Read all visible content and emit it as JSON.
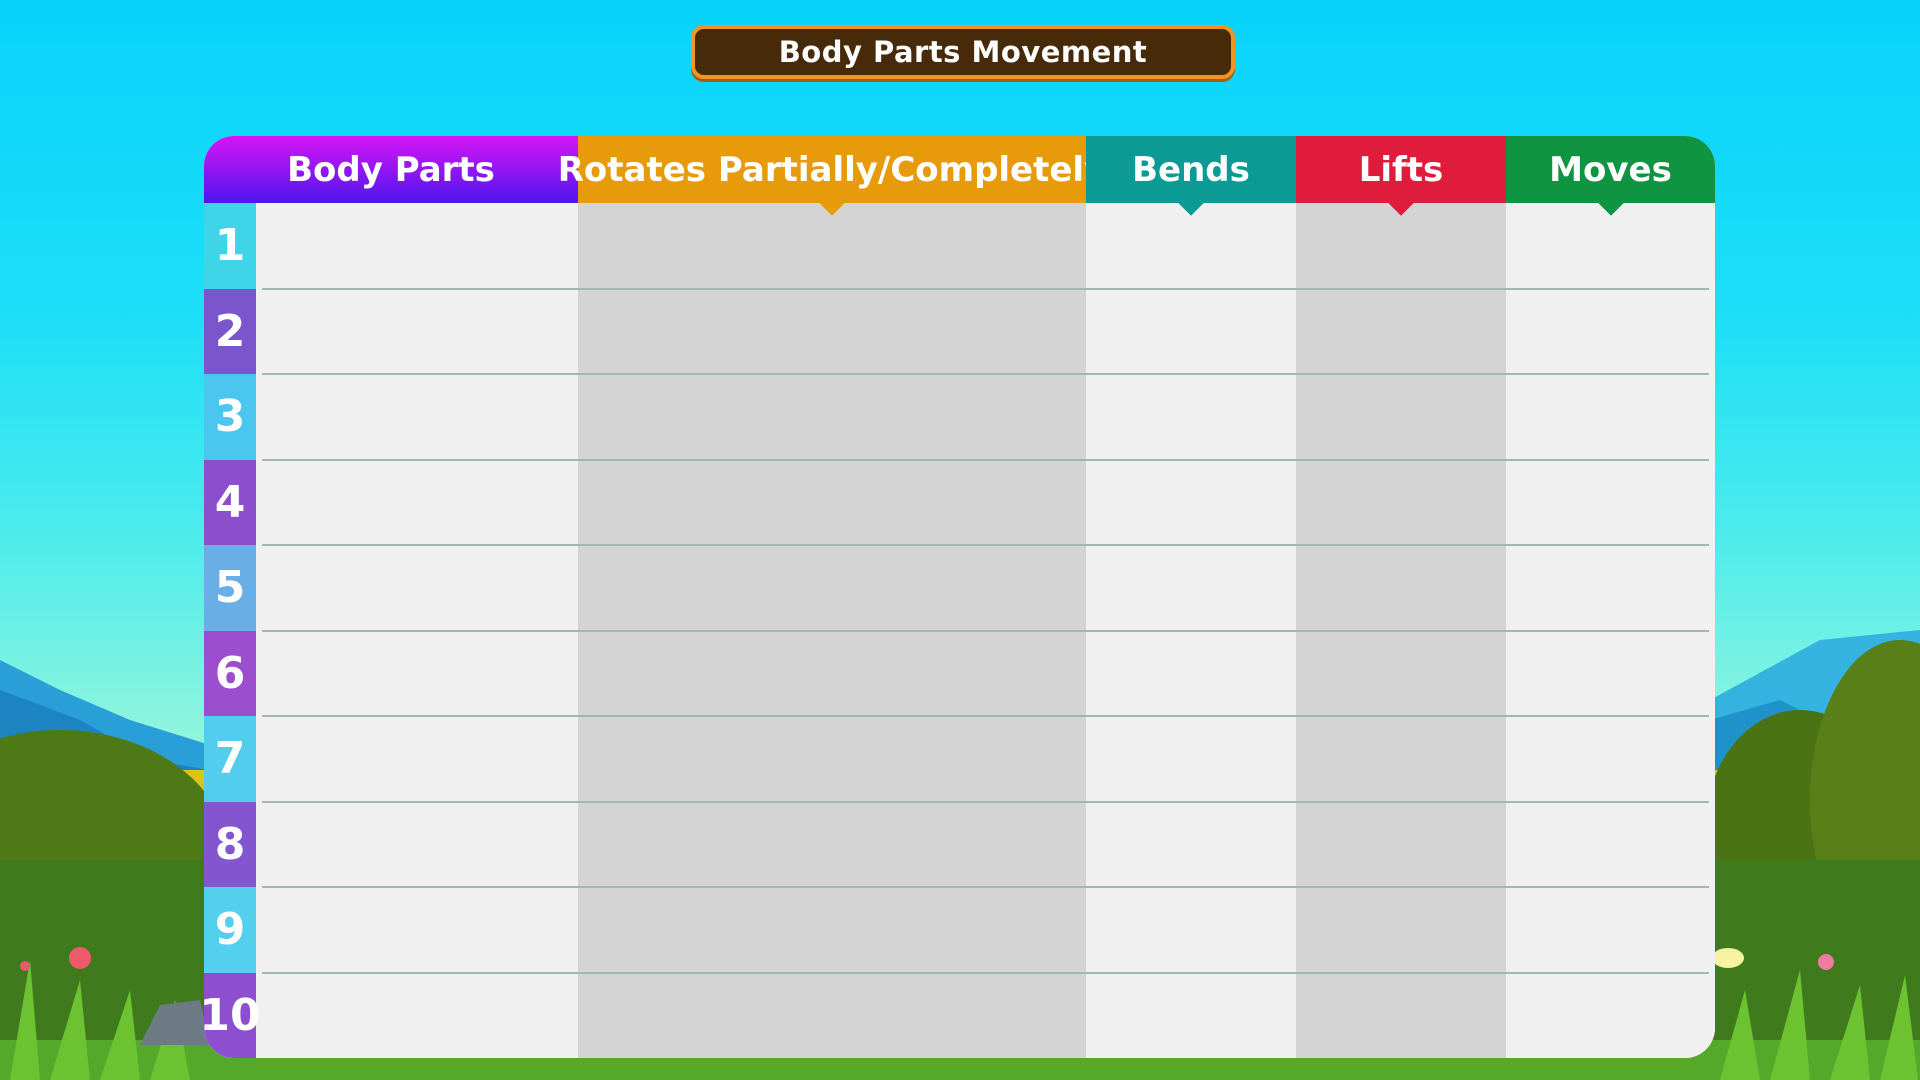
{
  "title": "Body Parts Movement",
  "columns": [
    {
      "label": "Body Parts",
      "color": "#6a1cf0"
    },
    {
      "label": "Rotates Partially/Completely",
      "color": "#e89b0a"
    },
    {
      "label": "Bends",
      "color": "#0b9b94"
    },
    {
      "label": "Lifts",
      "color": "#e01c3c"
    },
    {
      "label": "Moves",
      "color": "#0f9441"
    }
  ],
  "rows": [
    "1",
    "2",
    "3",
    "4",
    "5",
    "6",
    "7",
    "8",
    "9",
    "10"
  ],
  "row_colors": [
    "#3fd4e8",
    "#7a55cc",
    "#4bc6ee",
    "#8c4fcc",
    "#6aaee8",
    "#9b4fcf",
    "#53cdee",
    "#8356d0",
    "#55cfee",
    "#8d4fd0"
  ]
}
